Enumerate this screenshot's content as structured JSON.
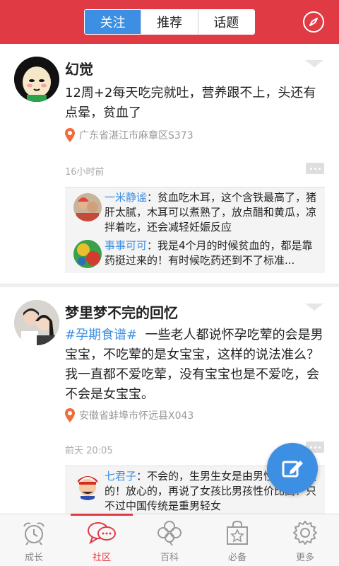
{
  "header": {
    "tabs": [
      {
        "label": "关注",
        "active": true
      },
      {
        "label": "推荐",
        "active": false
      },
      {
        "label": "话题",
        "active": false
      }
    ],
    "right_icon": "compass-icon"
  },
  "posts": [
    {
      "author": "幻觉",
      "content": "12周+2每天吃完就吐，营养跟不上，头还有点晕，贫血了",
      "location": "广东省湛江市麻章区S373",
      "time": "16小时前",
      "comments": [
        {
          "name": "一米静谧",
          "text": "：贫血吃木耳，这个含铁最高了，猪肝太腻，木耳可以煮熟了，放点醋和黄瓜，凉拌着吃，还会减轻妊娠反应"
        },
        {
          "name": "事事可可",
          "text": "：我是4个月的时候贫血的，都是靠药挺过来的！有时候吃药还到不了标准..."
        }
      ]
    },
    {
      "author": "梦里梦不完的回忆",
      "hashtag": "#孕期食谱#",
      "content": "一些老人都说怀孕吃荤的会是男宝宝，不吃荤的是女宝宝，这样的说法准么？我一直都不爱吃荤，没有宝宝也是不爱吃，会不会是女宝宝。",
      "location": "安徽省蚌埠市怀远县X043",
      "time": "前天 20:05",
      "comments": [
        {
          "name": "七君子",
          "text": "：不会的，生男生女是由男性基因决定的！放心的，再说了女孩比男孩性价比高！只不过中国传统是重男轻女"
        }
      ]
    }
  ],
  "fab_icon": "edit-icon",
  "bottom_nav": [
    {
      "label": "成长",
      "icon": "alarm-clock-icon",
      "active": false
    },
    {
      "label": "社区",
      "icon": "chat-bubbles-icon",
      "active": true
    },
    {
      "label": "百科",
      "icon": "clover-icon",
      "active": false
    },
    {
      "label": "必备",
      "icon": "shopping-bag-star-icon",
      "active": false
    },
    {
      "label": "更多",
      "icon": "gear-icon",
      "active": false
    }
  ],
  "colors": {
    "brand_red": "#e03b45",
    "accent_blue": "#3c8fe3"
  }
}
